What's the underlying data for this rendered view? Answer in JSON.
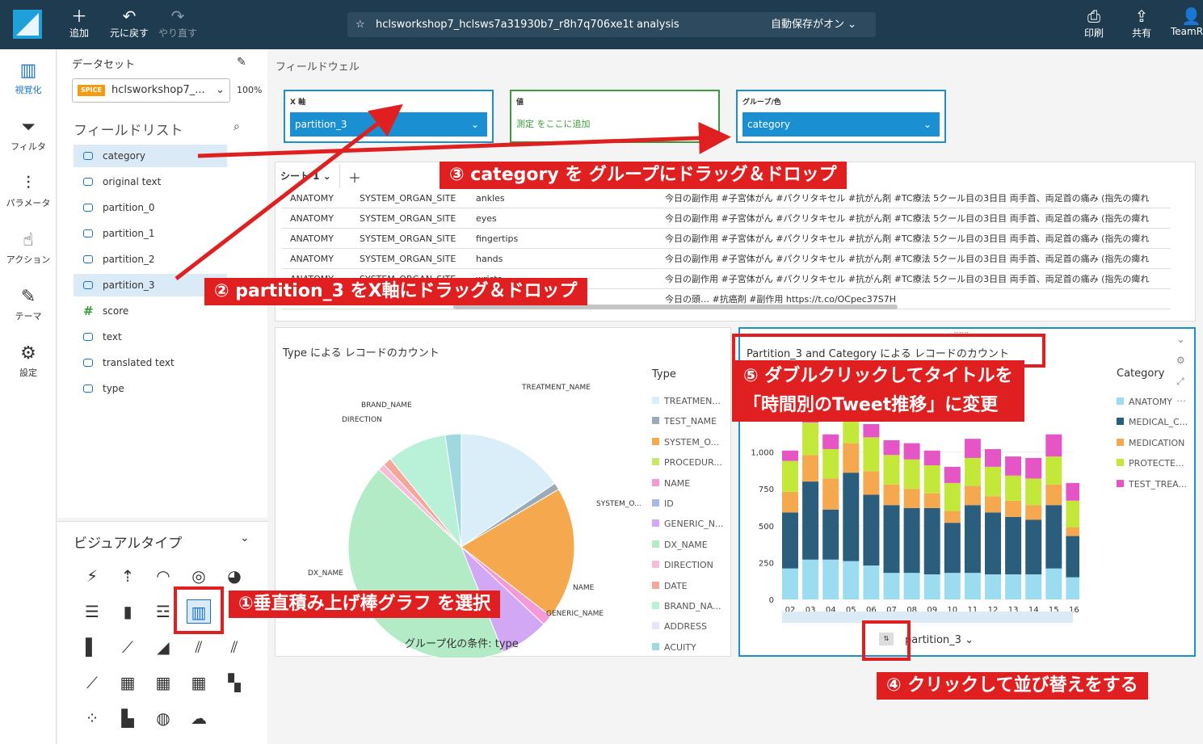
{
  "topbar": {
    "add": "追加",
    "undo": "元に戻す",
    "redo": "やり直す",
    "analysis_name": "hclsworkshop7_hclsws7a31930b7_r8h7q706xe1t analysis",
    "autosave": "自動保存がオン",
    "print": "印刷",
    "share": "共有",
    "user": "TeamR..."
  },
  "leftnav": [
    "視覚化",
    "フィルタ",
    "パラメータ",
    "アクション",
    "テーマ",
    "設定"
  ],
  "dataset": {
    "label": "データセット",
    "spice": "SPICE",
    "name": "hclsworkshop7_...",
    "percent": "100%"
  },
  "fieldlist": {
    "title": "フィールドリスト",
    "fields": [
      "category",
      "original text",
      "partition_0",
      "partition_1",
      "partition_2",
      "partition_3",
      "score",
      "text",
      "translated text",
      "type"
    ]
  },
  "visualtypes": {
    "title": "ビジュアルタイプ"
  },
  "fieldwells": {
    "title": "フィールドウェル",
    "x_label": "X 軸",
    "x_value": "partition_3",
    "value_label": "値",
    "value_placeholder": "測定 をここに追加",
    "group_label": "グループ/色",
    "group_value": "category"
  },
  "sheet": {
    "tab": "シート 1"
  },
  "table": {
    "rows": [
      [
        "ANATOMY",
        "SYSTEM_ORGAN_SITE",
        "ankles",
        "今日の副作用 #子宮体がん #パクリタキセル #抗がん剤 #TC療法 5クール目の3日目 両手首、両足首の痛み (指先の痺れ"
      ],
      [
        "ANATOMY",
        "SYSTEM_ORGAN_SITE",
        "eyes",
        "今日の副作用 #子宮体がん #パクリタキセル #抗がん剤 #TC療法 5クール目の3日目 両手首、両足首の痛み (指先の痺れ"
      ],
      [
        "ANATOMY",
        "SYSTEM_ORGAN_SITE",
        "fingertips",
        "今日の副作用 #子宮体がん #パクリタキセル #抗がん剤 #TC療法 5クール目の3日目 両手首、両足首の痛み (指先の痺れ"
      ],
      [
        "ANATOMY",
        "SYSTEM_ORGAN_SITE",
        "hands",
        "今日の副作用 #子宮体がん #パクリタキセル #抗がん剤 #TC療法 5クール目の3日目 両手首、両足首の痛み (指先の痺れ"
      ],
      [
        "ANATOMY",
        "SYSTEM_ORGAN_SITE",
        "wrists",
        "今日の副作用 #子宮体がん #パクリタキセル #抗がん剤 #TC療法 5クール目の3日目 両手首、両足首の痛み (指先の痺れ"
      ],
      [
        "",
        "",
        "",
        "今日の頭… #抗癌剤 #副作用 https://t.co/OCpec37S7H"
      ]
    ]
  },
  "pie": {
    "title": "Type による レコードのカウント",
    "footer": "グループ化の条件: type",
    "legend_title": "Type",
    "legend": [
      "TREATMEN...",
      "TEST_NAME",
      "SYSTEM_O...",
      "PROCEDUR...",
      "NAME",
      "ID",
      "GENERIC_N...",
      "DX_NAME",
      "DIRECTION",
      "DATE",
      "BRAND_NA...",
      "ADDRESS",
      "ACUITY"
    ],
    "labels": [
      "TREATMENT_NAME",
      "SYSTEM_O...",
      "NAME",
      "GENERIC_NAME",
      "DX_NAME",
      "DIRECTION",
      "BRAND_NAME"
    ],
    "colors": {
      "treatment": "#d9eef8",
      "test": "#9aaab9",
      "system": "#f5a84e",
      "procedure": "#c8e86a",
      "name": "#f59ad8",
      "id": "#aab8e8",
      "generic": "#d2a8f5",
      "dx": "#b2ebc5",
      "direction": "#f7bdd6",
      "date": "#f5a79a",
      "brand": "#b8f0d8",
      "address": "#e8e4f5",
      "acuity": "#a0d8e0"
    }
  },
  "bar": {
    "title": "Partition_3 and Category による レコードのカウント",
    "legend_title": "Category",
    "legend": [
      "ANATOMY",
      "MEDICAL_C...",
      "MEDICATION",
      "PROTECTE...",
      "TEST_TREA..."
    ],
    "colors": [
      "#9cdcf0",
      "#2b5d7d",
      "#f5a84e",
      "#c3e83a",
      "#e555c6"
    ],
    "x_field": "partition_3"
  },
  "chart_data": {
    "type": "bar",
    "categories": [
      "02",
      "03",
      "04",
      "05",
      "06",
      "07",
      "08",
      "09",
      "10",
      "11",
      "12",
      "13",
      "14",
      "15",
      "16"
    ],
    "ylim": [
      0,
      1250
    ],
    "yticks": [
      0,
      250,
      500,
      750,
      1000
    ],
    "series": [
      {
        "name": "ANATOMY",
        "values": [
          210,
          270,
          270,
          260,
          230,
          180,
          180,
          170,
          180,
          180,
          170,
          170,
          170,
          210,
          150
        ]
      },
      {
        "name": "MEDICAL_C...",
        "values": [
          380,
          530,
          340,
          600,
          480,
          460,
          440,
          450,
          340,
          460,
          420,
          390,
          370,
          430,
          280
        ]
      },
      {
        "name": "MEDICATION",
        "values": [
          140,
          180,
          210,
          200,
          160,
          140,
          130,
          100,
          80,
          130,
          110,
          110,
          100,
          140,
          60
        ]
      },
      {
        "name": "PROTECTE...",
        "values": [
          210,
          220,
          200,
          230,
          230,
          200,
          200,
          190,
          190,
          190,
          200,
          170,
          180,
          190,
          180
        ]
      },
      {
        "name": "TEST_TREA...",
        "values": [
          70,
          110,
          100,
          120,
          90,
          100,
          110,
          100,
          110,
          130,
          120,
          130,
          140,
          150,
          120
        ]
      }
    ]
  },
  "callouts": {
    "c1": "①垂直積み上げ棒グラフ を選択",
    "c2": "② partition_3 をX軸にドラッグ＆ドロップ",
    "c3": "③ category を グループにドラッグ＆ドロップ",
    "c4": "④ クリックして並び替えをする",
    "c5a": "⑤ ダブルクリックしてタイトルを",
    "c5b": "「時間別のTweet推移」に変更"
  }
}
